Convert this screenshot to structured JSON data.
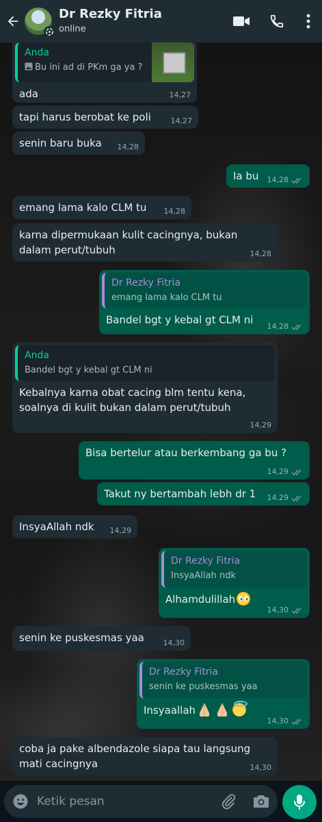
{
  "header": {
    "contact_name": "Dr Rezky Fitria",
    "status": "online",
    "icons": [
      "back-arrow-icon",
      "video-call-icon",
      "phone-icon",
      "more-vert-icon"
    ]
  },
  "messages": [
    {
      "dir": "in",
      "quote": {
        "author": "Anda",
        "text": "Bu ini ad di PKm ga ya ?",
        "has_image": true
      },
      "text": "ada",
      "time": "14,27"
    },
    {
      "dir": "in",
      "text": "tapi harus berobat ke poli",
      "time": "14,27"
    },
    {
      "dir": "in",
      "text": "senin baru buka",
      "time": "14,28"
    },
    {
      "dir": "out",
      "text": "Ia bu",
      "time": "14,28"
    },
    {
      "dir": "in",
      "text": "emang lama kalo CLM tu",
      "time": "14,28"
    },
    {
      "dir": "in",
      "text": "karna dipermukaan kulit cacingnya, bukan dalam perut/tubuh",
      "time": "14,28"
    },
    {
      "dir": "out",
      "quote": {
        "author": "Dr Rezky Fitria",
        "text": "emang lama kalo CLM tu"
      },
      "text": "Bandel bgt y kebal gt CLM ni",
      "time": "14,28"
    },
    {
      "dir": "in",
      "quote": {
        "author": "Anda",
        "text": "Bandel bgt y kebal gt CLM ni"
      },
      "text": "Kebalnya karna obat cacing blm tentu kena, soalnya di kulit bukan dalam perut/tubuh",
      "time": "14,29"
    },
    {
      "dir": "out",
      "text": "Bisa bertelur atau berkembang ga bu ?",
      "time": "14,29"
    },
    {
      "dir": "out",
      "text": "Takut ny bertambah lebh dr 1",
      "time": "14,29"
    },
    {
      "dir": "in",
      "text": "InsyaAllah ndk",
      "time": "14,29"
    },
    {
      "dir": "out",
      "quote": {
        "author": "Dr Rezky Fitria",
        "text": "InsyaAllah ndk"
      },
      "text": "Alhamdulillah",
      "emoji": "pleading-face-emoji",
      "time": "14,30"
    },
    {
      "dir": "in",
      "text": "senin ke puskesmas yaa",
      "time": "14,30"
    },
    {
      "dir": "out",
      "quote": {
        "author": "Dr Rezky Fitria",
        "text": "senin ke puskesmas yaa"
      },
      "text": "Insyaallah",
      "emoji": "folded-hands-halo-emoji",
      "time": "14,30"
    },
    {
      "dir": "in",
      "text": "coba ja pake albendazole siapa tau langsung mati cacingnya",
      "time": "14,30"
    }
  ],
  "composer": {
    "placeholder": "Ketik pesan",
    "icons": [
      "emoji-icon",
      "attach-icon",
      "camera-icon",
      "mic-icon"
    ]
  },
  "colors": {
    "header_bg": "#1f2c34",
    "incoming_bubble": "#1f2c34",
    "outgoing_bubble": "#005c4b",
    "accent": "#00a884",
    "quote_in_author": "#06cf9c",
    "quote_out_author": "#a78bdd"
  }
}
